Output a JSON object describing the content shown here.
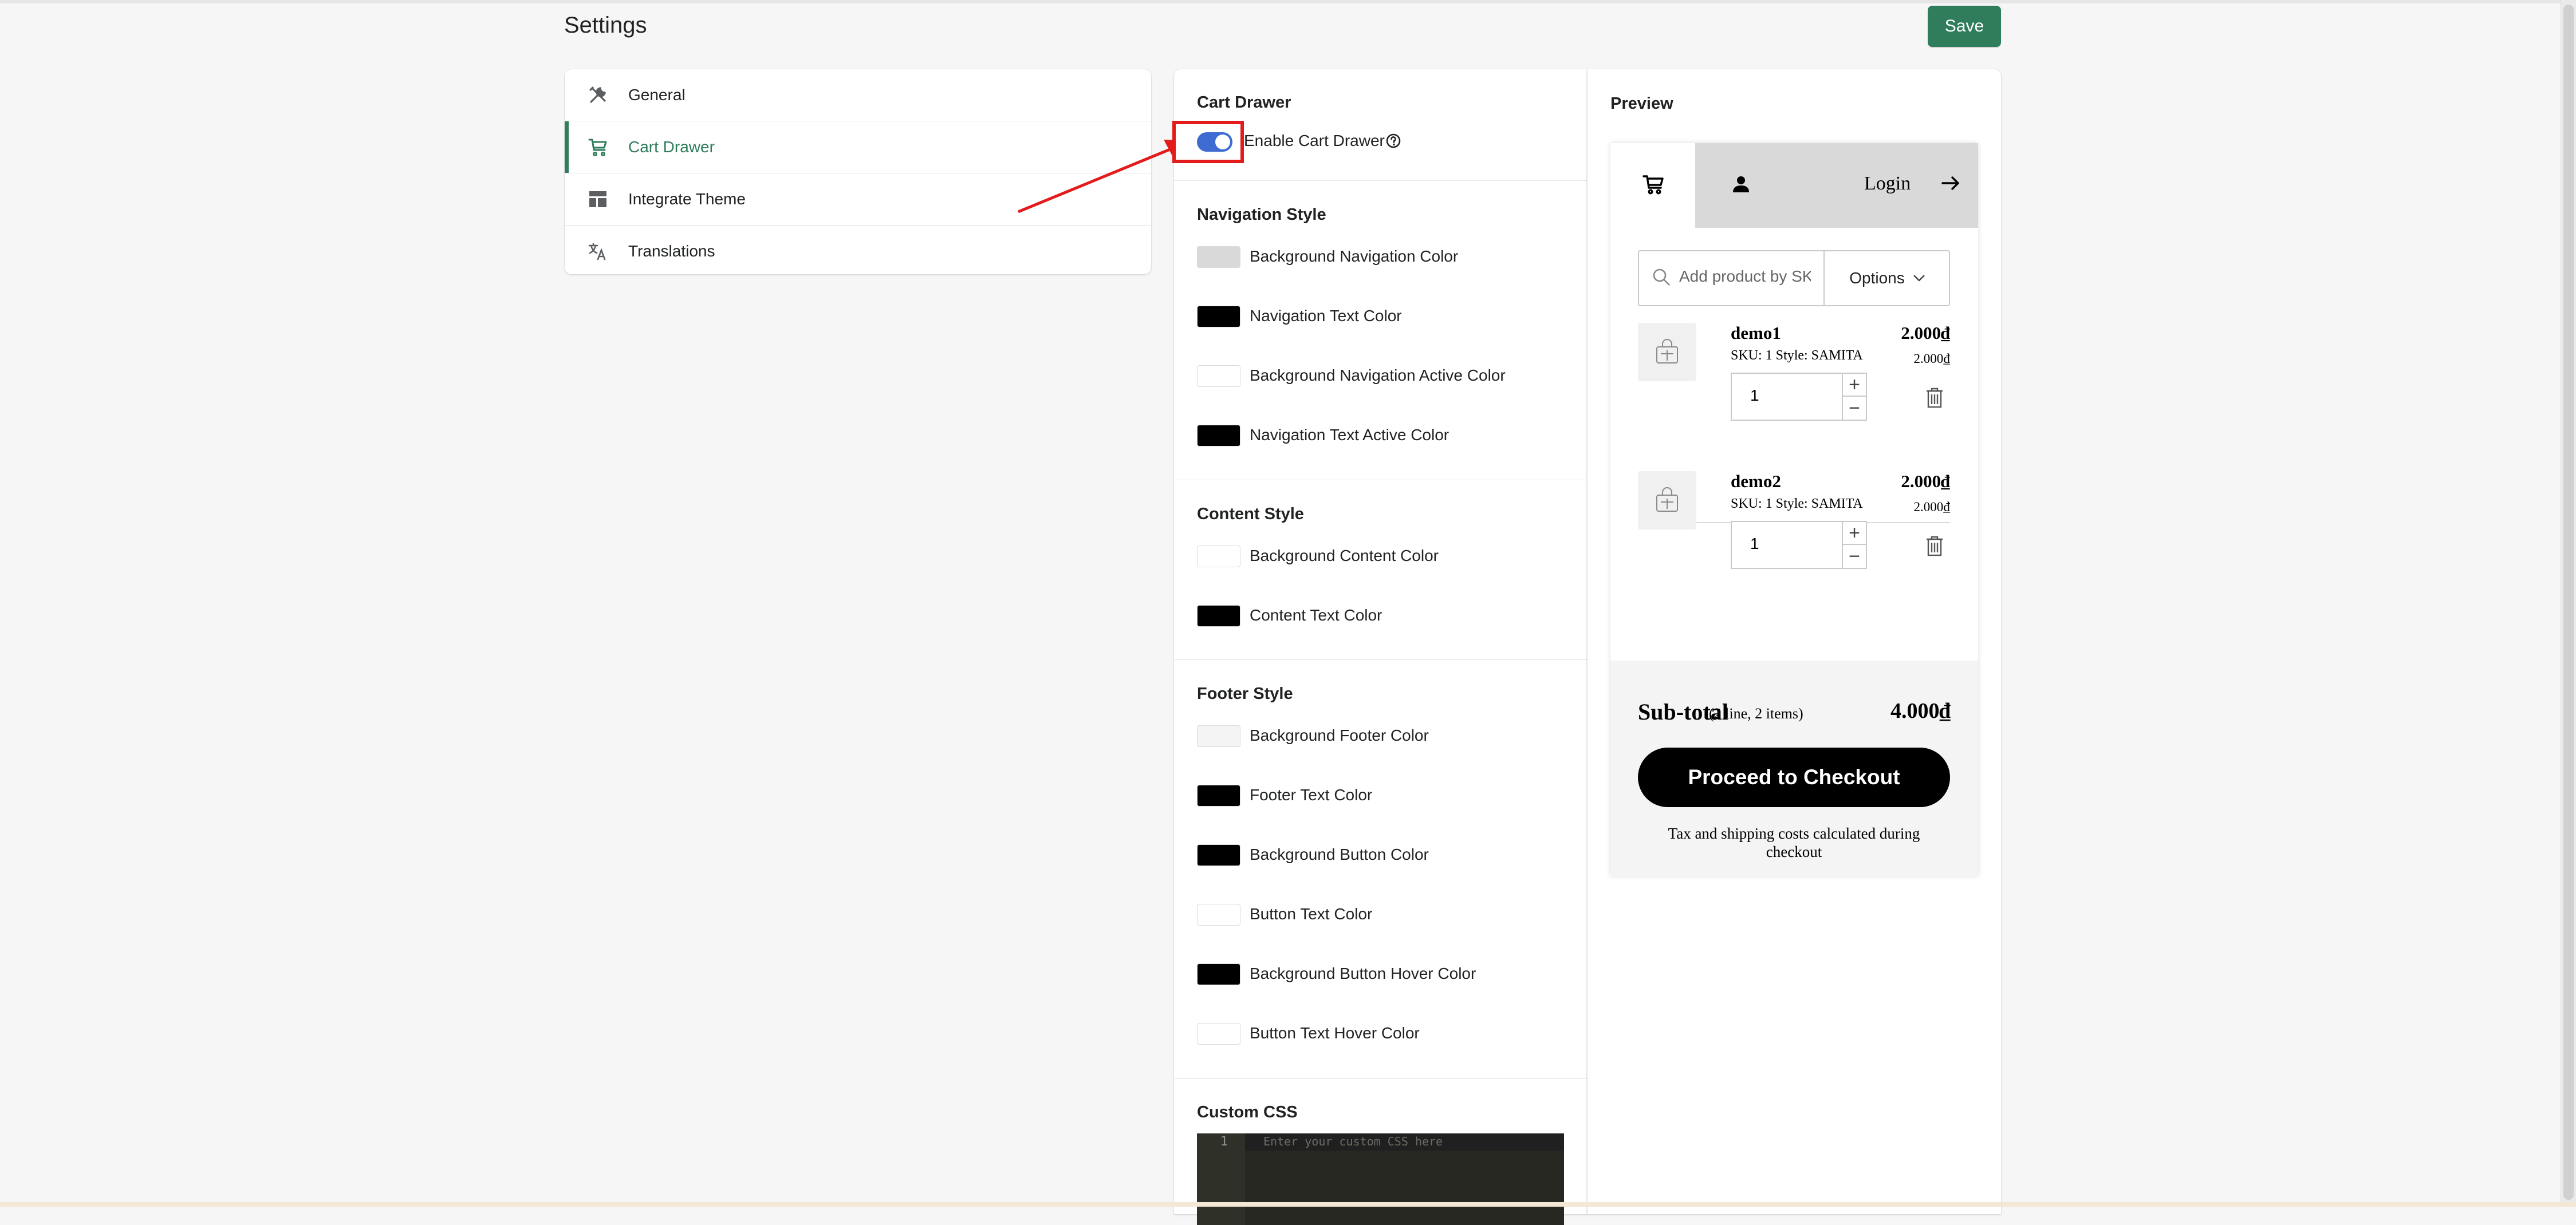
{
  "page": {
    "title": "Settings",
    "save_label": "Save"
  },
  "sidebar": {
    "items": [
      {
        "label": "General",
        "icon": "tools-icon",
        "active": false
      },
      {
        "label": "Cart Drawer",
        "icon": "cart-icon",
        "active": true
      },
      {
        "label": "Integrate Theme",
        "icon": "layout-icon",
        "active": false
      },
      {
        "label": "Translations",
        "icon": "translate-icon",
        "active": false
      }
    ]
  },
  "settings": {
    "cart_drawer": {
      "title": "Cart Drawer",
      "enable_label": "Enable Cart Drawer",
      "enabled": true
    },
    "navigation_style": {
      "title": "Navigation Style",
      "colors": [
        {
          "label": "Background Navigation Color",
          "value": "#d9d9d9"
        },
        {
          "label": "Navigation Text Color",
          "value": "#000000"
        },
        {
          "label": "Background Navigation Active Color",
          "value": "#ffffff"
        },
        {
          "label": "Navigation Text Active Color",
          "value": "#000000"
        }
      ]
    },
    "content_style": {
      "title": "Content Style",
      "colors": [
        {
          "label": "Background Content Color",
          "value": "#ffffff"
        },
        {
          "label": "Content Text Color",
          "value": "#000000"
        }
      ]
    },
    "footer_style": {
      "title": "Footer Style",
      "colors": [
        {
          "label": "Background Footer Color",
          "value": "#f4f4f4"
        },
        {
          "label": "Footer Text Color",
          "value": "#000000"
        },
        {
          "label": "Background Button Color",
          "value": "#000000"
        },
        {
          "label": "Button Text Color",
          "value": "#ffffff"
        },
        {
          "label": "Background Button Hover Color",
          "value": "#000000"
        },
        {
          "label": "Button Text Hover Color",
          "value": "#ffffff"
        }
      ]
    },
    "custom_css": {
      "title": "Custom CSS",
      "line_number": "1",
      "placeholder": "Enter your custom CSS here"
    }
  },
  "preview": {
    "title": "Preview",
    "login_label": "Login",
    "search_placeholder": "Add product by SKU",
    "options_label": "Options",
    "items": [
      {
        "name": "demo1",
        "sku": "SKU: 1 Style: SAMITA",
        "price": "2.000₫",
        "unit_price": "2.000₫",
        "qty": "1"
      },
      {
        "name": "demo2",
        "sku": "SKU: 1 Style: SAMITA",
        "price": "2.000₫",
        "unit_price": "2.000₫",
        "qty": "1"
      }
    ],
    "subtotal_label": "Sub-total",
    "subtotal_note": "(2 line, 2 items)",
    "subtotal_value": "4.000₫",
    "checkout_label": "Proceed to Checkout",
    "tax_note": "Tax and shipping costs calculated during checkout"
  },
  "colors": {
    "accent": "#2f7d5b",
    "toggle": "#3d6bd1",
    "annotation": "#e31b1b"
  }
}
